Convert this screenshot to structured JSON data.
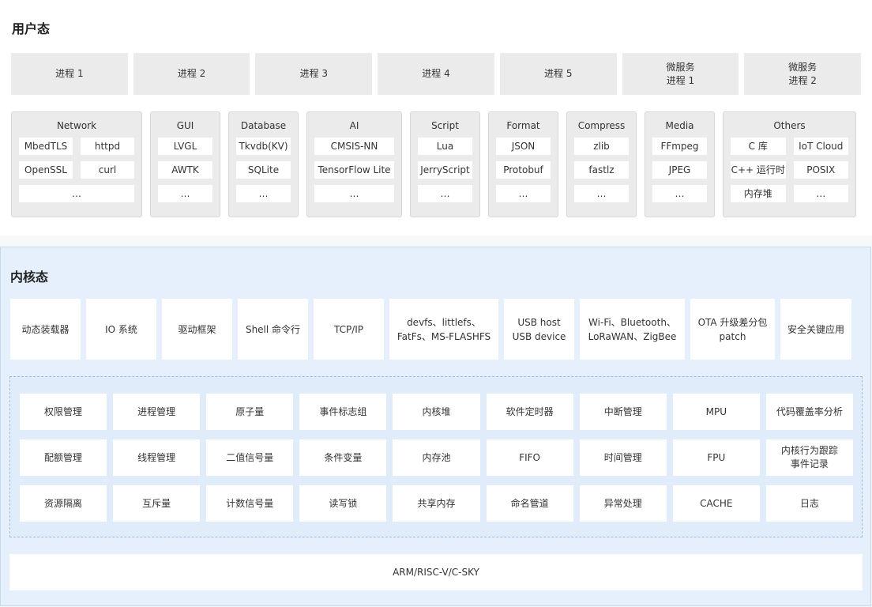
{
  "user_space": {
    "title": "用户态",
    "processes": [
      "进程 1",
      "进程 2",
      "进程 3",
      "进程 4",
      "进程 5",
      "微服务\n进程 1",
      "微服务\n进程 2"
    ],
    "lib_groups": [
      {
        "title": "Network",
        "cols": 2,
        "items": [
          "MbedTLS",
          "httpd",
          "OpenSSL",
          "curl",
          "..."
        ]
      },
      {
        "title": "GUI",
        "cols": 1,
        "items": [
          "LVGL",
          "AWTK",
          "..."
        ]
      },
      {
        "title": "Database",
        "cols": 1,
        "items": [
          "Tkvdb(KV)",
          "SQLite",
          "..."
        ]
      },
      {
        "title": "AI",
        "cols": 1,
        "items": [
          "CMSIS-NN",
          "TensorFlow Lite",
          "..."
        ]
      },
      {
        "title": "Script",
        "cols": 1,
        "items": [
          "Lua",
          "JerryScript",
          "..."
        ]
      },
      {
        "title": "Format",
        "cols": 1,
        "items": [
          "JSON",
          "Protobuf",
          "..."
        ]
      },
      {
        "title": "Compress",
        "cols": 1,
        "items": [
          "zlib",
          "fastlz",
          "..."
        ]
      },
      {
        "title": "Media",
        "cols": 1,
        "items": [
          "FFmpeg",
          "JPEG",
          "..."
        ]
      },
      {
        "title": "Others",
        "cols": 2,
        "items": [
          "C 库",
          "IoT Cloud",
          "C++ 运行时",
          "POSIX",
          "内存堆",
          "..."
        ]
      }
    ]
  },
  "kernel_space": {
    "title": "内核态",
    "modules": [
      "动态装载器",
      "IO 系统",
      "驱动框架",
      "Shell 命令行",
      "TCP/IP",
      "devfs、littlefs、\nFatFs、MS-FLASHFS",
      "USB host\nUSB device",
      "Wi-Fi、Bluetooth、\nLoRaWAN、ZigBee",
      "OTA 升级差分包\npatch",
      "安全关键应用"
    ],
    "core_rows": [
      [
        "权限管理",
        "进程管理",
        "原子量",
        "事件标志组",
        "内核堆",
        "软件定时器",
        "中断管理",
        "MPU",
        "代码覆盖率分析"
      ],
      [
        "配额管理",
        "线程管理",
        "二值信号量",
        "条件变量",
        "内存池",
        "FIFO",
        "时间管理",
        "FPU",
        "内核行为跟踪\n事件记录"
      ],
      [
        "资源隔离",
        "互斥量",
        "计数信号量",
        "读写锁",
        "共享内存",
        "命名管道",
        "异常处理",
        "CACHE",
        "日志"
      ]
    ],
    "arch": "ARM/RISC-V/C-SKY"
  },
  "colors": {
    "user_bg": "#ffffff",
    "kernel_bg": "#e6f0fc",
    "box_grey": "#ebebeb",
    "dashed_border": "#9ebbe2"
  }
}
